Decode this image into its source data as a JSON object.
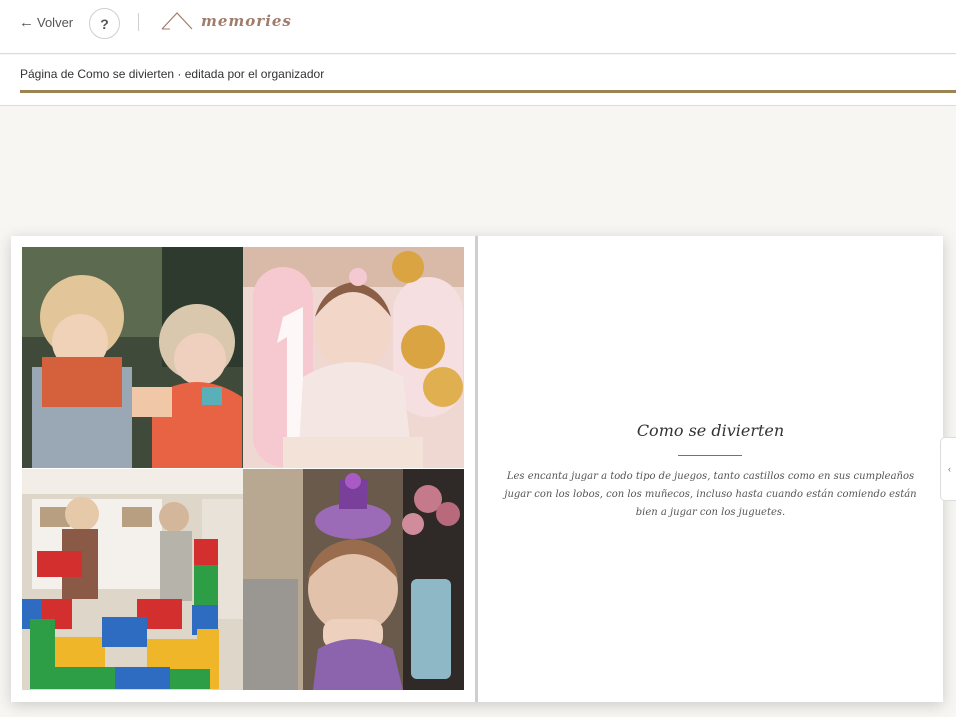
{
  "header": {
    "back_label": "Volver",
    "help_label": "?",
    "logo_text": "memories"
  },
  "subbar": {
    "text": "Página de Como se divierten · editada por el organizador"
  },
  "book": {
    "title": "Como se divierten",
    "body": "Les encanta jugar a todo tipo de juegos, tanto castillos como en sus cumpleaños jugar con los lobos, con los muñecos, incluso hasta cuando están comiendo están bien a jugar con los juguetes."
  },
  "side_tab": {
    "icon": "chevron-left-icon",
    "glyph": "‹"
  },
  "colors": {
    "accent_line": "#9b8452",
    "logo": "#a07c6c",
    "background": "#f7f6f2"
  }
}
